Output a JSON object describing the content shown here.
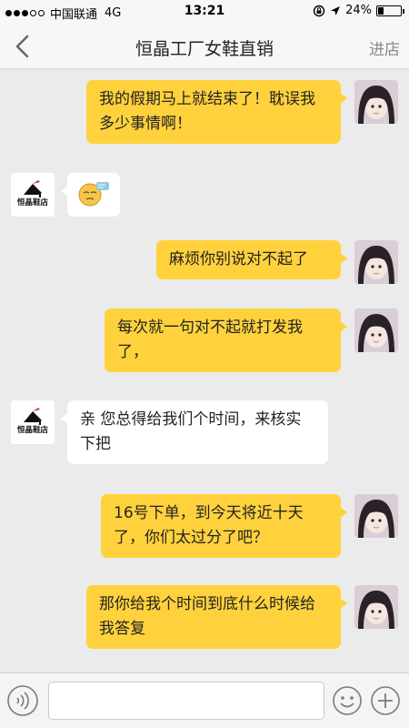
{
  "status_bar": {
    "carrier": "中国联通",
    "network": "4G",
    "time": "13:21",
    "battery": "24%",
    "battery_level": 0.24,
    "signal_bars": 3
  },
  "nav": {
    "title": "恒晶工厂女鞋直销",
    "store_label": "进店"
  },
  "shop": {
    "logo_text": "恒晶鞋店",
    "avatar_colors": {
      "heel": "#c0392b",
      "text": "#111111"
    }
  },
  "messages": [
    {
      "side": "out",
      "text": "我的假期马上就结束了！耽误我多少事情啊！"
    },
    {
      "side": "in",
      "emoji": "sleepy-emoji"
    },
    {
      "side": "out",
      "text": "麻烦你别说对不起了"
    },
    {
      "side": "out",
      "text": "每次就一句对不起就打发我了，"
    },
    {
      "side": "in",
      "text": "亲 您总得给我们个时间，来核实下把"
    },
    {
      "side": "out",
      "text": "16号下单，到今天将近十天了，你们太过分了吧？"
    },
    {
      "side": "out",
      "text": "那你给我个时间到底什么时候给我答复"
    }
  ],
  "input": {
    "value": "",
    "placeholder": ""
  },
  "colors": {
    "outgoing_bubble": "#ffd23d",
    "incoming_bubble": "#ffffff",
    "chat_background": "#ebebeb"
  }
}
